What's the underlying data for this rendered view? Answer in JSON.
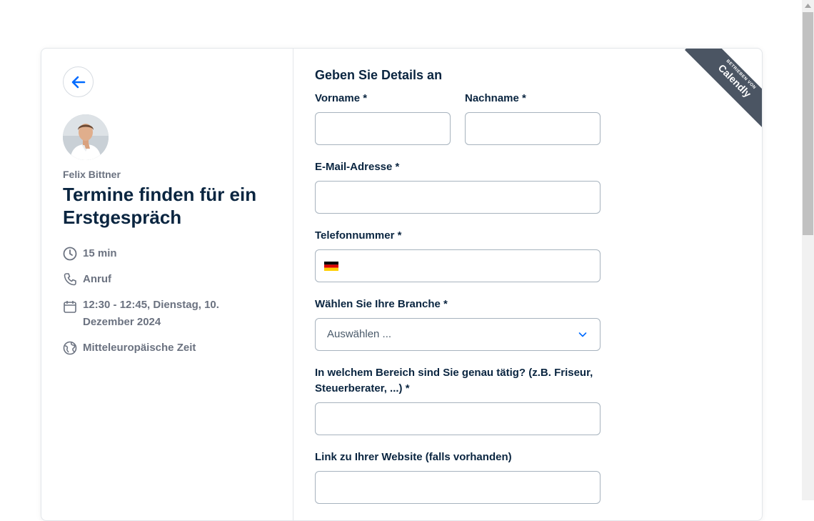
{
  "host": {
    "name": "Felix Bittner"
  },
  "event": {
    "title": "Termine finden für ein Erstgespräch",
    "duration": "15 min",
    "type": "Anruf",
    "datetime": "12:30 - 12:45, Dienstag, 10. Dezember 2024",
    "timezone": "Mitteleuropäische Zeit"
  },
  "form": {
    "title": "Geben Sie Details an",
    "first_name_label": "Vorname *",
    "last_name_label": "Nachname *",
    "email_label": "E-Mail-Adresse *",
    "phone_label": "Telefonnummer *",
    "branch_label": "Wählen Sie Ihre Branche *",
    "branch_placeholder": "Auswählen ...",
    "area_label": "In welchem Bereich sind Sie genau tätig? (z.B. Friseur, Steuerberater, ...) *",
    "website_label": "Link zu Ihrer Website (falls vorhanden)"
  },
  "badge": {
    "small": "BETRIEBEN VON",
    "brand": "Calendly"
  },
  "colors": {
    "accent": "#006bff",
    "text": "#0a2540",
    "muted": "#6b7280"
  }
}
